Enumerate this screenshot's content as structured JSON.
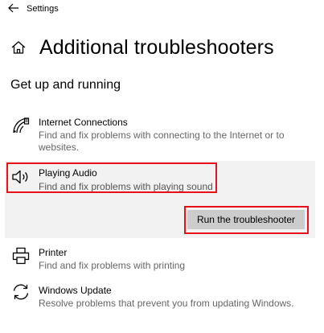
{
  "window": {
    "app_title": "Settings"
  },
  "page": {
    "title": "Additional troubleshooters"
  },
  "section": {
    "heading": "Get up and running"
  },
  "troubleshooters": [
    {
      "title": "Internet Connections",
      "description": "Find and fix problems with connecting to the Internet or to websites.",
      "icon": "wifi-icon"
    },
    {
      "title": "Playing Audio",
      "description": "Find and fix problems with playing sound",
      "icon": "speaker-icon",
      "expanded": true,
      "action_label": "Run the troubleshooter"
    },
    {
      "title": "Printer",
      "description": "Find and fix problems with printing",
      "icon": "printer-icon"
    },
    {
      "title": "Windows Update",
      "description": "Resolve problems that prevent you from updating Windows.",
      "icon": "refresh-icon"
    }
  ],
  "colors": {
    "highlight": "#e8101a",
    "expanded_bg": "#f2f2f2",
    "button_bg": "#cccccc"
  }
}
